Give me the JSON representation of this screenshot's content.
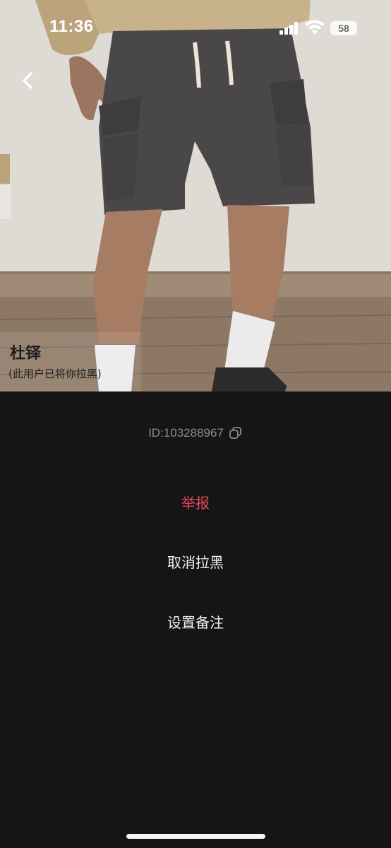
{
  "status_bar": {
    "time": "11:36",
    "battery_level": "58",
    "signal_icon": "cellular-signal-icon",
    "wifi_icon": "wifi-icon",
    "battery_icon": "battery-icon"
  },
  "navigation": {
    "back_icon": "chevron-left-icon"
  },
  "profile": {
    "name": "杜铎",
    "block_status": "(此用户已将你拉黑)",
    "id_text": "ID:103288967",
    "copy_icon": "copy-icon"
  },
  "actions": {
    "report_label": "举报",
    "unblock_label": "取消拉黑",
    "set_remark_label": "设置备注"
  },
  "colors": {
    "background": "#151515",
    "report_red": "#e8485a",
    "id_gray": "#8c8c8c",
    "action_text": "#f2f2f2"
  }
}
